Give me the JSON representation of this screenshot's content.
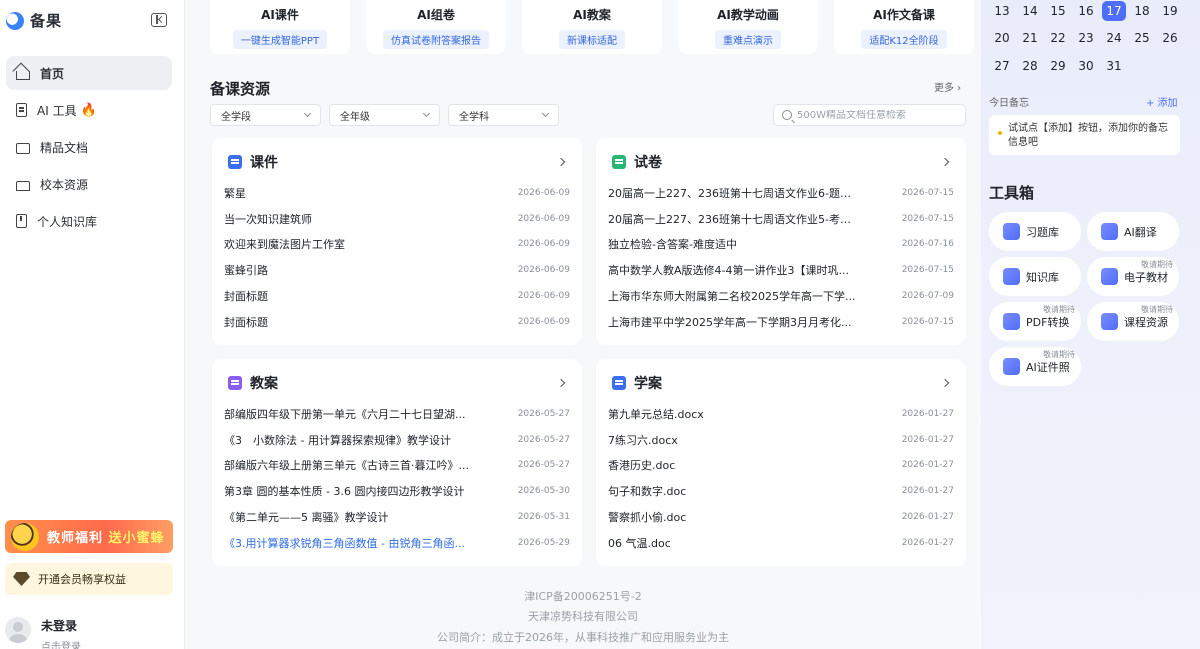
{
  "sidebar": {
    "logo_text": "备果",
    "nav": [
      {
        "label": "首页",
        "icon": "home-icon"
      },
      {
        "label": "AI 工具",
        "icon": "document-icon"
      },
      {
        "label": "精品文档",
        "icon": "folder-icon"
      },
      {
        "label": "校本资源",
        "icon": "school-icon"
      },
      {
        "label": "个人知识库",
        "icon": "book-icon"
      }
    ],
    "promo": {
      "text": "教师福利",
      "highlight": "送小蜜蜂"
    },
    "member_text": "开通会员畅享权益",
    "user": {
      "name": "未登录",
      "sub": "点击登录"
    }
  },
  "main": {
    "tools": [
      {
        "title": "AI课件",
        "tag": "一键生成智能PPT"
      },
      {
        "title": "AI组卷",
        "tag": "仿真试卷附答案报告"
      },
      {
        "title": "AI教案",
        "tag": "新课标适配"
      },
      {
        "title": "AI教学动画",
        "tag": "重难点演示"
      },
      {
        "title": "AI作文备课",
        "tag": "适配K12全阶段"
      }
    ],
    "section_title": "备课资源",
    "more": "更多",
    "filters": [
      "全学段",
      "全年级",
      "全学科"
    ],
    "search_placeholder": "500W精品文档任意检索",
    "panels": {
      "courseware": {
        "title": "课件",
        "color": "#3c6ff0",
        "rows": [
          {
            "title": "繁星",
            "date": "2026-06-09"
          },
          {
            "title": "当一次知识建筑师",
            "date": "2026-06-09"
          },
          {
            "title": "欢迎来到魔法图片工作室",
            "date": "2026-06-09"
          },
          {
            "title": "蜜蜂引路",
            "date": "2026-06-09"
          },
          {
            "title": "封面标题",
            "date": "2026-06-09"
          },
          {
            "title": "封面标题",
            "date": "2026-06-09"
          }
        ]
      },
      "exam": {
        "title": "试卷",
        "color": "#2bb673",
        "rows": [
          {
            "title": "20届高一上227、236班第十七周语文作业6-题库...",
            "date": "2026-07-15"
          },
          {
            "title": "20届高一上227、236班第十七周语文作业5-考查...",
            "date": "2026-07-15"
          },
          {
            "title": "独立检验-含答案-难度适中",
            "date": "2026-07-16"
          },
          {
            "title": "高中数学人教A版选修4-4第一讲作业3【课时巩...",
            "date": "2026-07-15"
          },
          {
            "title": "上海市华东师大附属第二名校2025学年高一下学...",
            "date": "2026-07-09"
          },
          {
            "title": "上海市建平中学2025学年高一下学期3月月考化...",
            "date": "2026-07-15"
          }
        ]
      },
      "lesson": {
        "title": "教案",
        "color": "#8a5cf0",
        "rows": [
          {
            "title": "部编版四年级下册第一单元《六月二十七日望湖...",
            "date": "2026-05-27"
          },
          {
            "title": "《3　小数除法 - 用计算器探索规律》教学设计",
            "date": "2026-05-27"
          },
          {
            "title": "部编版六年级上册第三单元《古诗三首·暮江吟》...",
            "date": "2026-05-27"
          },
          {
            "title": "第3章 圆的基本性质 - 3.6 圆内接四边形教学设计",
            "date": "2026-05-30"
          },
          {
            "title": "《第二单元——5 离骚》教学设计",
            "date": "2026-05-31"
          },
          {
            "title": "《3.用计算器求锐角三角函数值 - 由锐角三角函...",
            "date": "2026-05-29"
          }
        ]
      },
      "study": {
        "title": "学案",
        "color": "#3c6ff0",
        "rows": [
          {
            "title": "第九单元总结.docx",
            "date": "2026-01-27"
          },
          {
            "title": "7练习六.docx",
            "date": "2026-01-27"
          },
          {
            "title": "香港历史.doc",
            "date": "2026-01-27"
          },
          {
            "title": "句子和数字.doc",
            "date": "2026-01-27"
          },
          {
            "title": "警察抓小偷.doc",
            "date": "2026-01-27"
          },
          {
            "title": "06 气温.doc",
            "date": "2026-01-27"
          }
        ]
      }
    },
    "footer": [
      "津ICP备20006251号-2",
      "天津凉势科技有限公司",
      "公司简介：成立于2026年，从事科技推广和应用服务业为主"
    ]
  },
  "right": {
    "calendar_rows": [
      [
        "13",
        "14",
        "15",
        "16",
        "17",
        "18",
        "19"
      ],
      [
        "20",
        "21",
        "22",
        "23",
        "24",
        "25",
        "26"
      ],
      [
        "27",
        "28",
        "29",
        "30",
        "31",
        "",
        ""
      ]
    ],
    "today": "17",
    "memo_label": "今日备忘",
    "memo_add": "+ 添加",
    "memo_text": "试试点【添加】按钮，添加你的备忘信息吧",
    "toolbox_title": "工具箱",
    "toolbox": [
      {
        "label": "习题库",
        "badge": ""
      },
      {
        "label": "AI翻译",
        "badge": ""
      },
      {
        "label": "知识库",
        "badge": ""
      },
      {
        "label": "电子教材",
        "badge": "敬请期待"
      },
      {
        "label": "PDF转换",
        "badge": "敬请期待"
      },
      {
        "label": "课程资源",
        "badge": "敬请期待"
      },
      {
        "label": "AI证件照",
        "badge": "敬请期待"
      }
    ]
  }
}
